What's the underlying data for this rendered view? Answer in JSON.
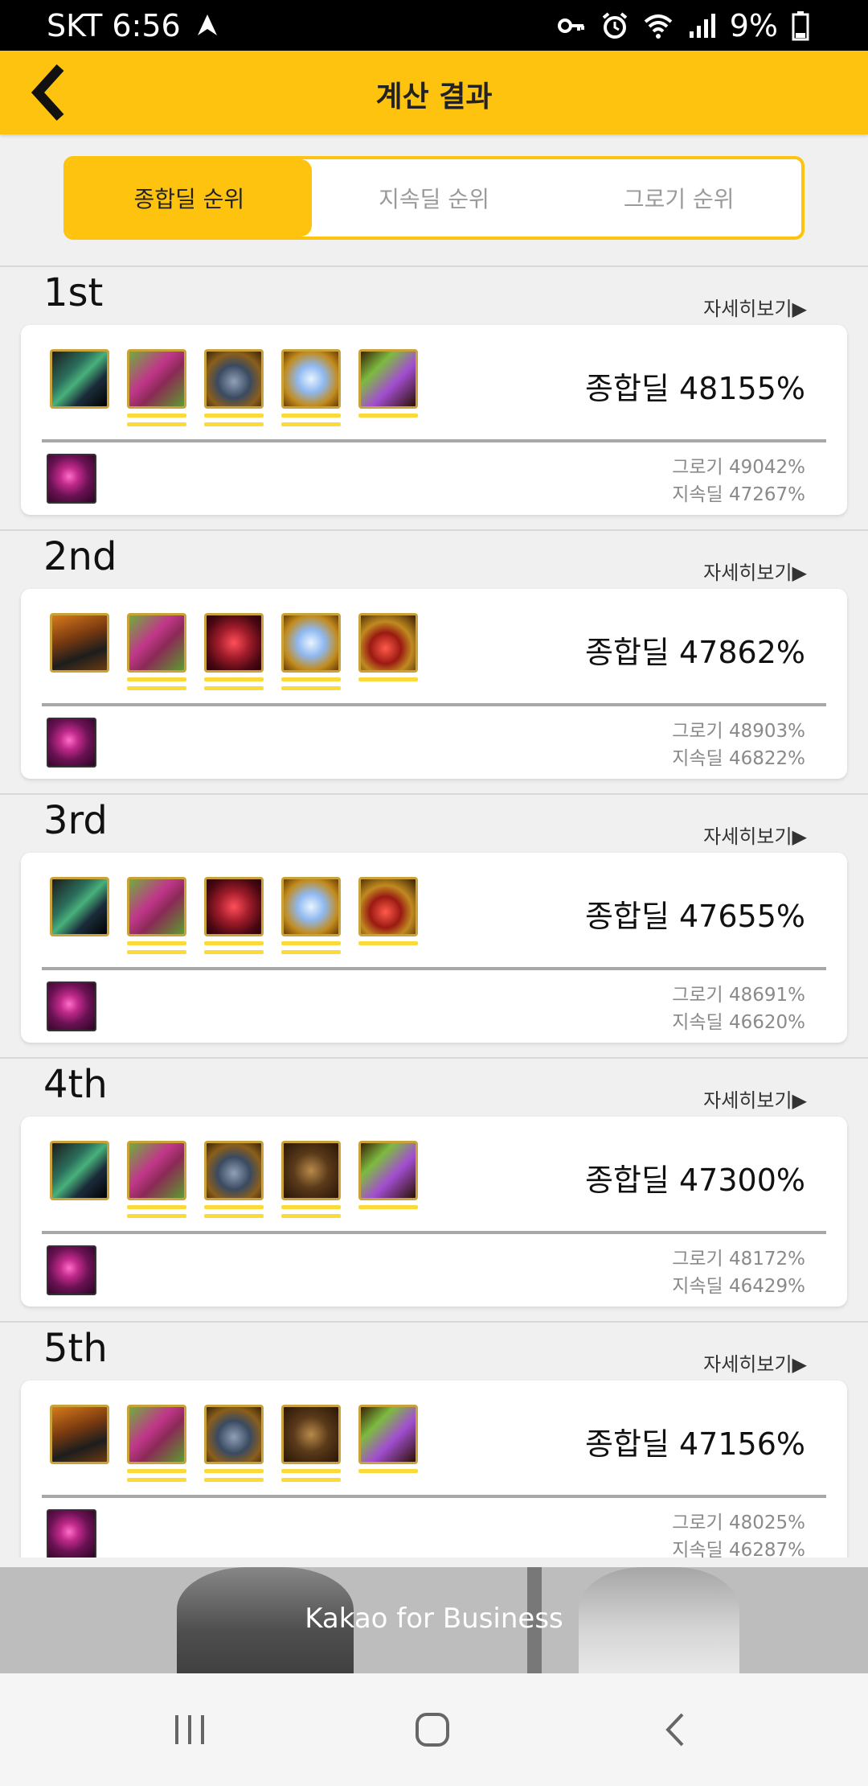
{
  "status_bar": {
    "carrier_time": "SKT 6:56",
    "battery": "9%"
  },
  "header": {
    "title": "계산 결과"
  },
  "tabs": [
    {
      "label": "종합딜 순위",
      "active": true
    },
    {
      "label": "지속딜 순위",
      "active": false
    },
    {
      "label": "그로기 순위",
      "active": false
    }
  ],
  "detail_label": "자세히보기▶",
  "results": [
    {
      "rank": "1st",
      "total": "종합딜 48155%",
      "groggy": "그로기 49042%",
      "sustain": "지속딜 47267%"
    },
    {
      "rank": "2nd",
      "total": "종합딜 47862%",
      "groggy": "그로기 48903%",
      "sustain": "지속딜 46822%"
    },
    {
      "rank": "3rd",
      "total": "종합딜 47655%",
      "groggy": "그로기 48691%",
      "sustain": "지속딜 46620%"
    },
    {
      "rank": "4th",
      "total": "종합딜 47300%",
      "groggy": "그로기 48172%",
      "sustain": "지속딜 46429%"
    },
    {
      "rank": "5th",
      "total": "종합딜 47156%",
      "groggy": "그로기 48025%",
      "sustain": "지속딜 46287%"
    }
  ],
  "ad": {
    "text": "Kakao for Business"
  },
  "colors": {
    "accent": "#fec30f",
    "underline": "#fbdb3c"
  }
}
